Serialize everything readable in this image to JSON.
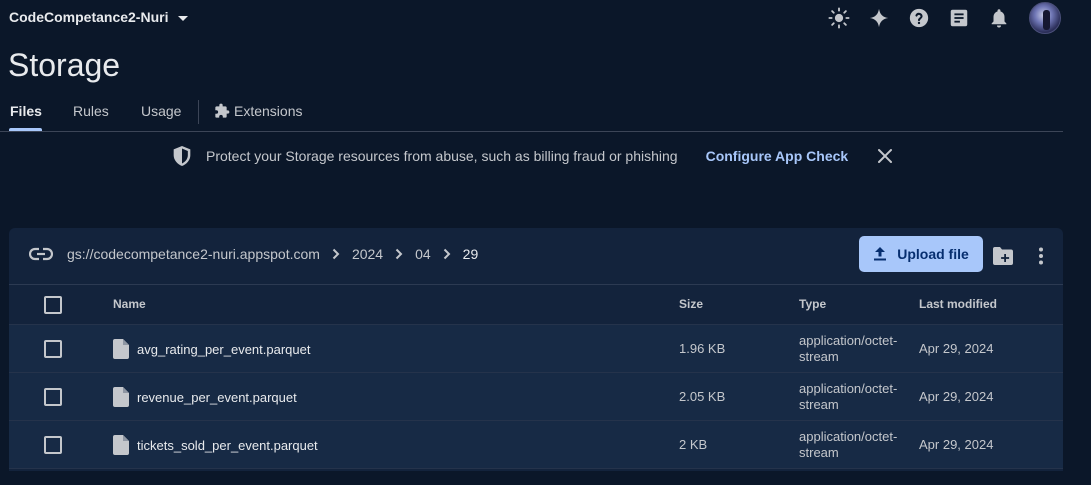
{
  "project": {
    "name": "CodeCompetance2-Nuri"
  },
  "top_icons": [
    "theme-icon",
    "gemini-spark-icon",
    "help-icon",
    "release-notes-icon",
    "notifications-icon",
    "avatar"
  ],
  "page": {
    "title": "Storage"
  },
  "tabs": [
    {
      "label": "Files",
      "active": true
    },
    {
      "label": "Rules",
      "active": false
    },
    {
      "label": "Usage",
      "active": false
    },
    {
      "label": "Extensions",
      "active": false
    }
  ],
  "banner": {
    "text": "Protect your Storage resources from abuse, such as billing fraud or phishing",
    "link": "Configure App Check"
  },
  "path": {
    "bucket": "gs://codecompetance2-nuri.appspot.com",
    "segments": [
      "2024",
      "04",
      "29"
    ]
  },
  "actions": {
    "upload": "Upload file"
  },
  "table": {
    "columns": {
      "name": "Name",
      "size": "Size",
      "type": "Type",
      "modified": "Last modified"
    },
    "rows": [
      {
        "name": "avg_rating_per_event.parquet",
        "size": "1.96 KB",
        "type": "application/octet-stream",
        "modified": "Apr 29, 2024"
      },
      {
        "name": "revenue_per_event.parquet",
        "size": "2.05 KB",
        "type": "application/octet-stream",
        "modified": "Apr 29, 2024"
      },
      {
        "name": "tickets_sold_per_event.parquet",
        "size": "2 KB",
        "type": "application/octet-stream",
        "modified": "Apr 29, 2024"
      }
    ]
  },
  "colors": {
    "background": "#0b1729",
    "card": "#13233c",
    "accent": "#a8c7fa"
  }
}
